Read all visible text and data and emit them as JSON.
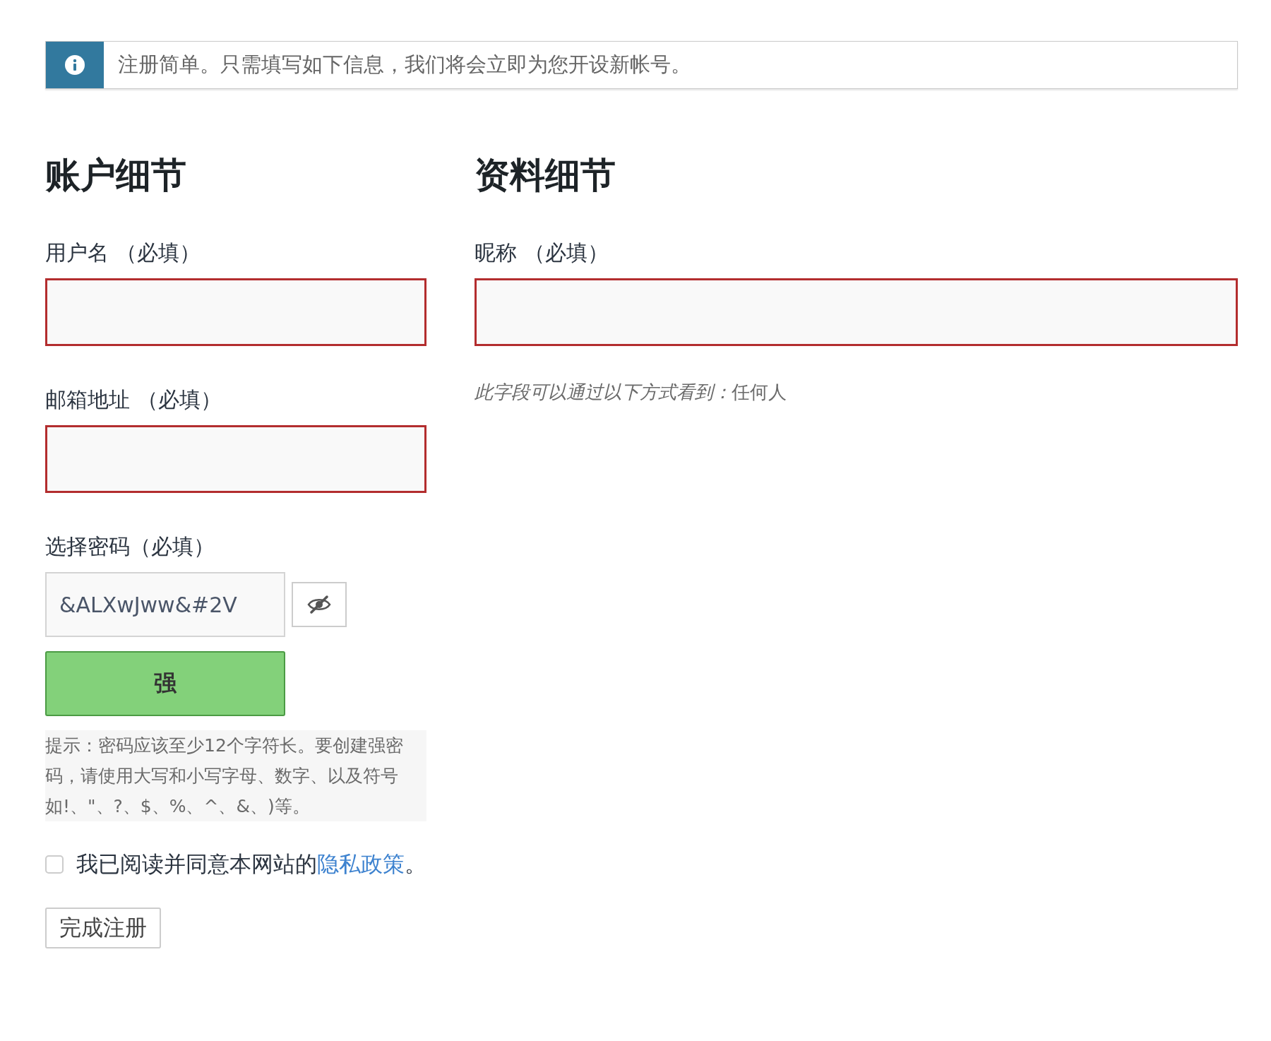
{
  "notice": {
    "text": "注册简单。只需填写如下信息，我们将会立即为您开设新帐号。"
  },
  "account": {
    "heading": "账户细节",
    "fields": [
      {
        "label": "用户名 （必填）",
        "invalid": true
      },
      {
        "label": "邮箱地址 （必填）",
        "invalid": true
      }
    ],
    "password": {
      "label": "选择密码（必填）",
      "value": "&ALXwJww&#2V",
      "strength": {
        "label": "强",
        "kind": "strong"
      },
      "hint": "提示：密码应该至少12个字符长。要创建强密码，请使用大写和小写字母、数字、以及符号如!、\"、?、$、%、^、&、)等。"
    }
  },
  "profile": {
    "heading": "资料细节",
    "fields": [
      {
        "label": "昵称 （必填）",
        "invalid": true
      }
    ],
    "visibility": {
      "prefix": "此字段可以通过以下方式看到：",
      "value": "任何人"
    }
  },
  "consent": {
    "checked": false,
    "text": "我已阅读并同意本网站的",
    "link": "隐私政策",
    "suffix": "。"
  },
  "submit": "完成注册"
}
